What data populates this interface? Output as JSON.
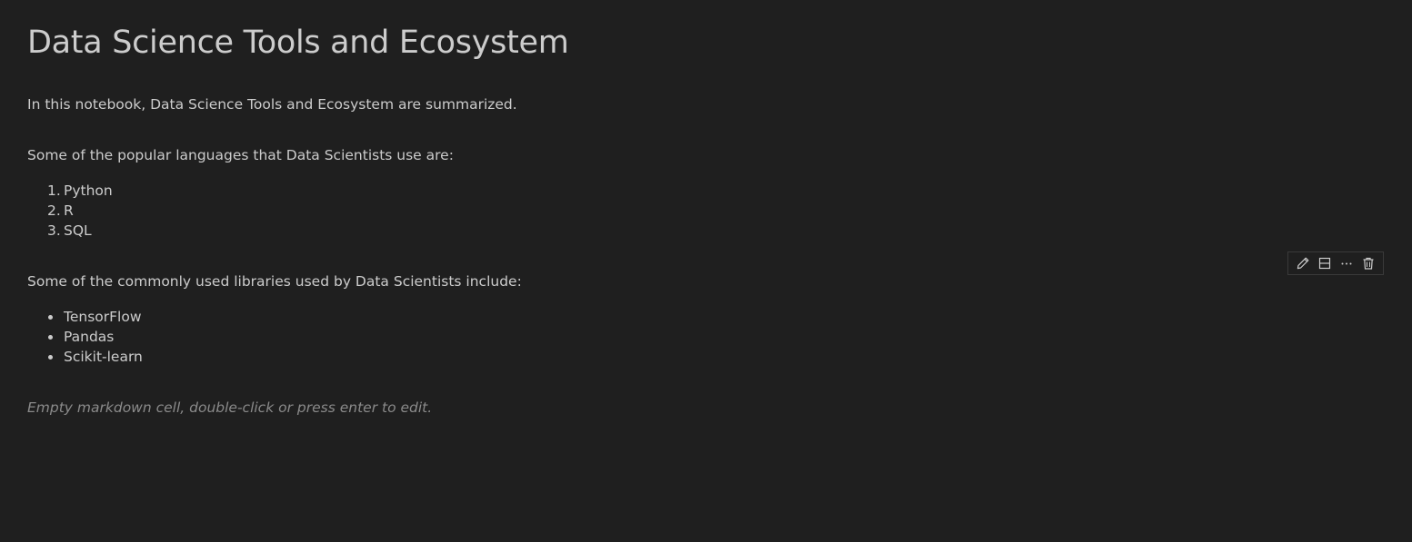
{
  "cell": {
    "title": "Data Science Tools and Ecosystem",
    "intro": "In this notebook, Data Science Tools and Ecosystem are summarized.",
    "languages_heading": "Some of the popular languages that Data Scientists use are:",
    "languages": [
      {
        "number": "1.",
        "label": "Python"
      },
      {
        "number": "2.",
        "label": "R"
      },
      {
        "number": "3.",
        "label": "SQL"
      }
    ],
    "libraries_heading": "Some of the commonly used libraries used by Data Scientists include:",
    "libraries": [
      "TensorFlow",
      "Pandas",
      "Scikit-learn"
    ]
  },
  "empty_cell": {
    "placeholder": "Empty markdown cell, double-click or press enter to edit."
  },
  "toolbar": {
    "icons": [
      "pencil-icon",
      "split-cell-icon",
      "more-icon",
      "trash-icon"
    ]
  },
  "colors": {
    "background": "#1f1f1f",
    "text": "#cccccc",
    "placeholder_text": "#8a8a8a",
    "toolbar_border": "#3a3a3a"
  }
}
